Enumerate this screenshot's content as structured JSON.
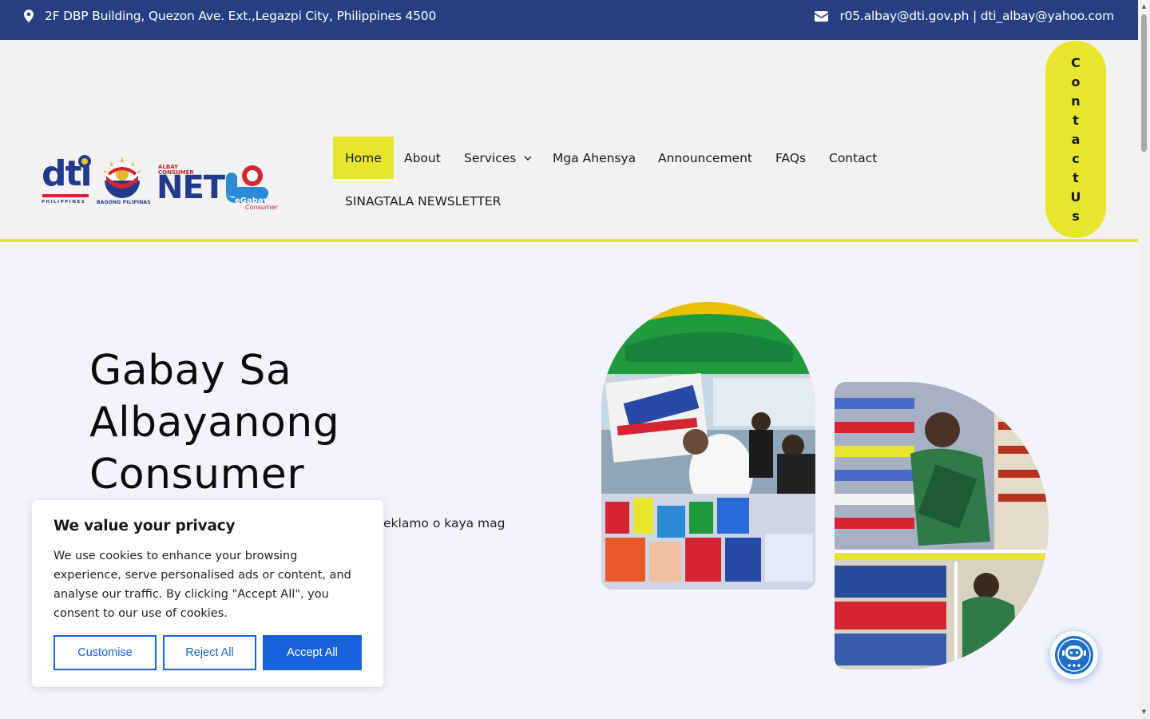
{
  "topbar": {
    "address": "2F DBP Building, Quezon Ave. Ext.,Legazpi City, Philippines 4500",
    "email": "r05.albay@dti.gov.ph | dti_albay@yahoo.com"
  },
  "logos": {
    "dti": "dti",
    "dti_sub": "PHILIPPINES",
    "bagong_pilipinas": "BAGONG PILIPINAS",
    "albay_consumer_top": "ALBAY",
    "albay_consumer_mid": "CONSUMER",
    "net": "NET",
    "egabay": "eGabay",
    "egabay_sub": "Consumer"
  },
  "nav": {
    "items": [
      "Home",
      "About",
      "Services",
      "Mga Ahensya",
      "Announcement",
      "FAQs",
      "Contact",
      "SINAGTALA NEWSLETTER"
    ],
    "active": "Home"
  },
  "contact_pill": {
    "letters": [
      "C",
      "o",
      "n",
      "t",
      "a",
      "c",
      "t",
      "U",
      "s"
    ]
  },
  "hero": {
    "title_line1": "Gabay Sa",
    "title_line2": "Albayanong",
    "title_line3": "Consumer",
    "description_visible": "eklamo o kaya mag"
  },
  "cookie": {
    "title": "We value your privacy",
    "body": "We use cookies to enhance your browsing experience, serve personalised ads or content, and analyse our traffic. By clicking \"Accept All\", you consent to our use of cookies.",
    "customise": "Customise",
    "reject": "Reject All",
    "accept": "Accept All"
  },
  "colors": {
    "topbar": "#253f82",
    "accent_yellow": "#e8e52e",
    "button_blue": "#1863dc"
  }
}
